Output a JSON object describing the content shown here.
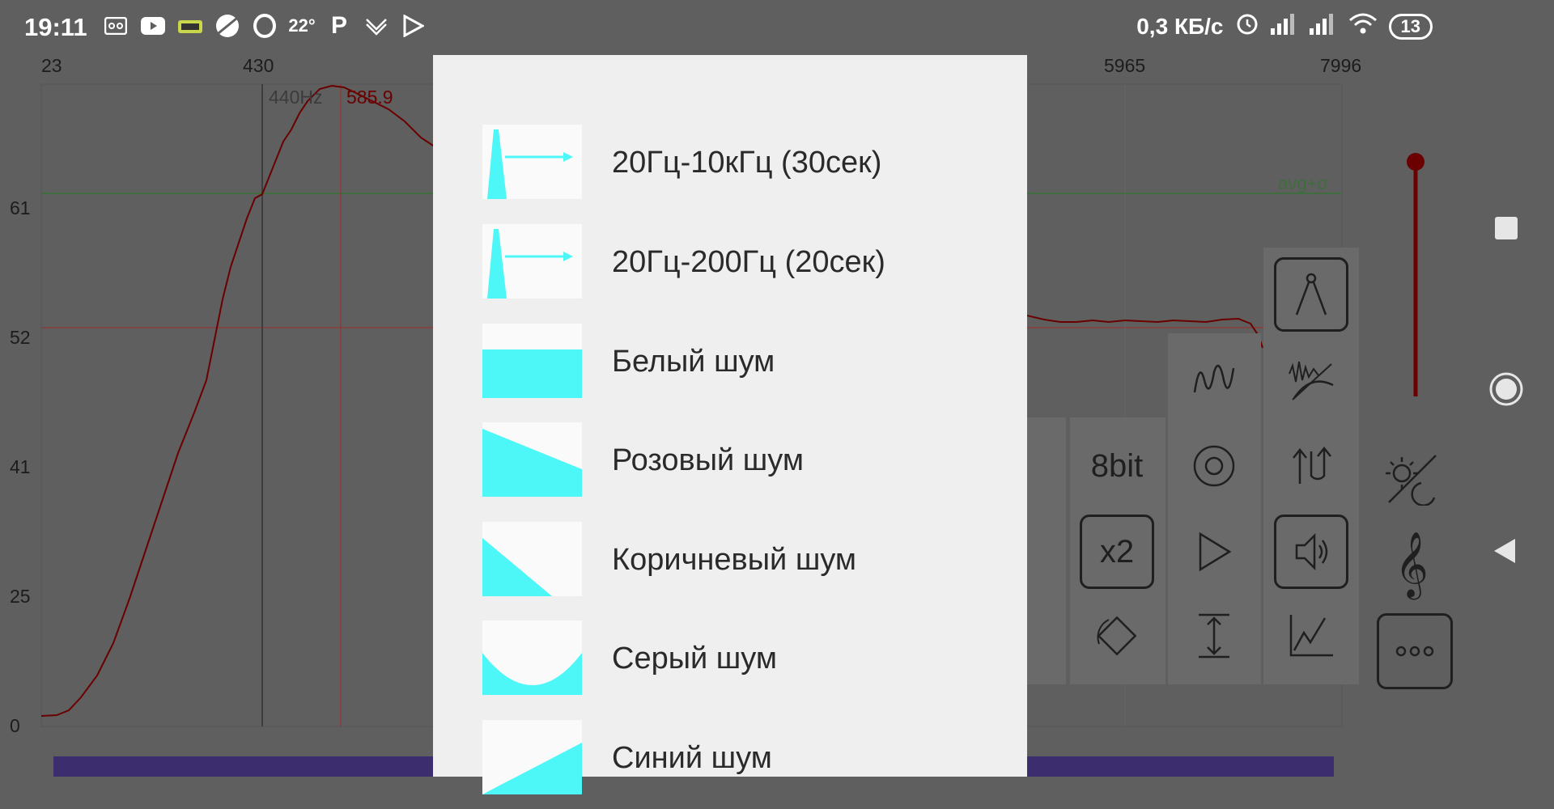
{
  "status_bar": {
    "time": "19:11",
    "temperature": "22°",
    "p_badge": "P",
    "net_speed": "0,3 КБ/с",
    "battery": "13",
    "icons": [
      "voicemail-icon",
      "youtube-icon",
      "ruler-icon",
      "planet-icon",
      "opera-icon",
      "temperature-label",
      "p-icon",
      "vk-icon",
      "play-store-icon",
      "alarm-icon",
      "signal-icon",
      "signal-icon",
      "wifi-icon",
      "battery-icon"
    ]
  },
  "chart": {
    "x_ticks": [
      "23",
      "430",
      "5965",
      "7996"
    ],
    "y_ticks": [
      "61",
      "52",
      "41",
      "25",
      "0"
    ],
    "marker_440": "440Hz",
    "peak_label": "585.9",
    "avg_label": "avg+σ",
    "colors": {
      "curve": "#6b0000",
      "avg_line": "#3f6d3f",
      "level_line": "#8a3b3b",
      "marker": "#3d3d3d"
    }
  },
  "tools": {
    "bit_label": "8bit",
    "zoom_label": "x2"
  },
  "side_nav": {
    "icons": [
      "stop-icon",
      "home-icon",
      "back-icon"
    ]
  },
  "dialog": {
    "items": [
      {
        "label": "20Гц-10кГц (30сек)",
        "thumb": "sweep"
      },
      {
        "label": "20Гц-200Гц (20сек)",
        "thumb": "sweep"
      },
      {
        "label": "Белый шум",
        "thumb": "white"
      },
      {
        "label": "Розовый шум",
        "thumb": "pink"
      },
      {
        "label": "Коричневый шум",
        "thumb": "brown"
      },
      {
        "label": "Серый шум",
        "thumb": "grey"
      },
      {
        "label": "Синий шум",
        "thumb": "blue"
      }
    ],
    "thumb_color": "#4ef7f7"
  }
}
